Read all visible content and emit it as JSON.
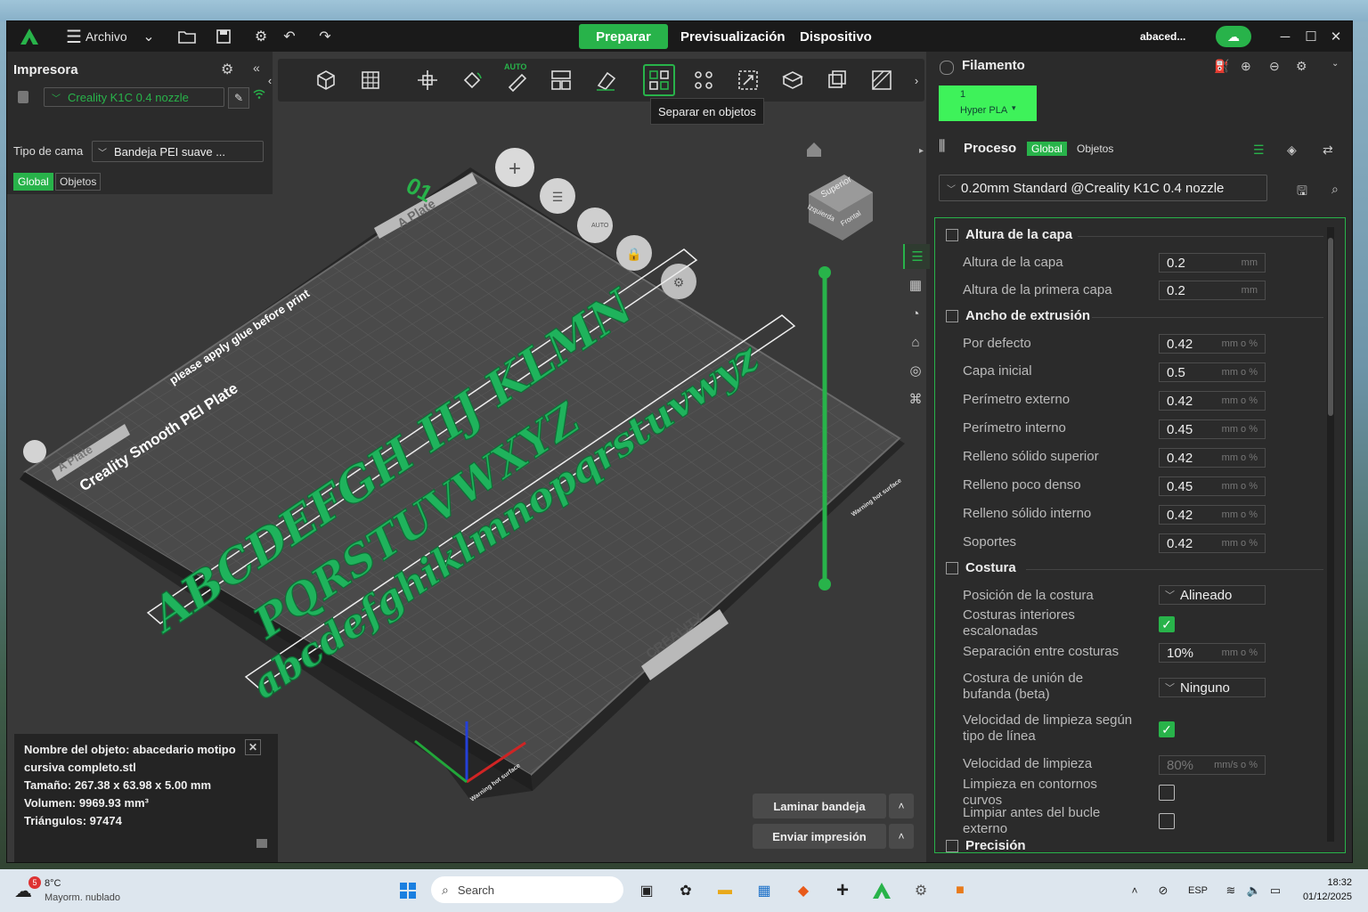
{
  "titlebar": {
    "menu_label": "Archivo",
    "tabs": [
      "Preparar",
      "Previsualización",
      "Dispositivo"
    ],
    "account": "abaced...",
    "accent": "#28b34a"
  },
  "printer": {
    "title": "Impresora",
    "name": "Creality K1C 0.4 nozzle",
    "bed_label": "Tipo de cama",
    "bed_value": "Bandeja PEI suave ...",
    "seg_global": "Global",
    "seg_objects": "Objetos"
  },
  "toolbar": {
    "auto_badge": "AUTO",
    "tooltip": "Separar en objetos"
  },
  "scene": {
    "plate_number": "01",
    "glue_notice": "please apply glue before print",
    "plate_name": "Creality Smooth PEI Plate",
    "plate_label_a": "A Plate",
    "plate_label_b": "A Plate",
    "brand": "CREALITY",
    "warning": "Warning hot surface",
    "warning_b": "Warning hot surface",
    "auto_badge": "AUTO",
    "cube_top": "Superior",
    "cube_left": "Izquierda",
    "cube_front": "Frontal",
    "text_line1": "ABCDEFGH IIJ KLMN",
    "text_line2": "PQRSTUVWXYZ",
    "text_line3": "abcdefghiklmnopqrstuvwyz"
  },
  "object_info": {
    "name_line1": "Nombre del objeto: abacedario motipo",
    "name_line2": "cursiva completo.stl",
    "size": "Tamaño: 267.38 x 63.98 x 5.00 mm",
    "volume": "Volumen: 9969.93 mm³",
    "triangles": "Triángulos: 97474"
  },
  "actions": {
    "slice": "Laminar bandeja",
    "send": "Enviar impresión"
  },
  "filament": {
    "title": "Filamento",
    "slot": "1",
    "type": "Hyper PLA",
    "chip_color": "#3ef25a"
  },
  "process": {
    "title": "Proceso",
    "seg_global": "Global",
    "seg_objects": "Objetos",
    "preset": "0.20mm Standard @Creality K1C 0.4 nozzle"
  },
  "settings": {
    "layer_height": {
      "title": "Altura de la capa",
      "rows": [
        {
          "label": "Altura de la capa",
          "value": "0.2",
          "unit": "mm"
        },
        {
          "label": "Altura de la primera capa",
          "value": "0.2",
          "unit": "mm"
        }
      ]
    },
    "line_width": {
      "title": "Ancho de extrusión",
      "rows": [
        {
          "label": "Por defecto",
          "value": "0.42",
          "unit": "mm o %"
        },
        {
          "label": "Capa inicial",
          "value": "0.5",
          "unit": "mm o %"
        },
        {
          "label": "Perímetro externo",
          "value": "0.42",
          "unit": "mm o %"
        },
        {
          "label": "Perímetro interno",
          "value": "0.45",
          "unit": "mm o %"
        },
        {
          "label": "Relleno sólido superior",
          "value": "0.42",
          "unit": "mm o %"
        },
        {
          "label": "Relleno poco denso",
          "value": "0.45",
          "unit": "mm o %"
        },
        {
          "label": "Relleno sólido interno",
          "value": "0.42",
          "unit": "mm o %"
        },
        {
          "label": "Soportes",
          "value": "0.42",
          "unit": "mm o %"
        }
      ]
    },
    "seam": {
      "title": "Costura",
      "position_label": "Posición de la costura",
      "position_value": "Alineado",
      "staggered_label_1": "Costuras interiores",
      "staggered_label_2": "escalonadas",
      "gap_label": "Separación entre costuras",
      "gap_value": "10%",
      "gap_unit": "mm o %",
      "scarf_label_1": "Costura de unión de",
      "scarf_label_2": "bufanda (beta)",
      "scarf_value": "Ninguno",
      "wipe_speed_type_1": "Velocidad de limpieza según",
      "wipe_speed_type_2": "tipo de línea",
      "wipe_speed_label": "Velocidad de limpieza",
      "wipe_speed_value": "80%",
      "wipe_speed_unit": "mm/s o %",
      "wipe_contour_1": "Limpieza en contornos",
      "wipe_contour_2": "curvos",
      "wipe_before_1": "Limpiar antes del bucle",
      "wipe_before_2": "externo"
    },
    "next_section": "Precisión"
  },
  "taskbar": {
    "weather_temp": "8°C",
    "weather_desc": "Mayorm. nublado",
    "weather_badge": "5",
    "search_placeholder": "Search",
    "lang": "ESP",
    "time": "18:32",
    "date": "01/12/2025"
  }
}
